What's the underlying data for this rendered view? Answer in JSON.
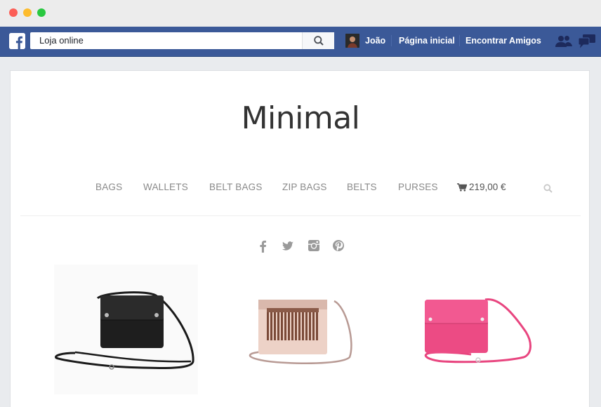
{
  "facebook": {
    "search_value": "Loja online",
    "user_name": "João",
    "home_link": "Página inicial",
    "find_friends_link": "Encontrar Amigos",
    "brand_color": "#3b5998"
  },
  "store": {
    "title": "Minimal",
    "nav": [
      "BAGS",
      "WALLETS",
      "BELT BAGS",
      "ZIP BAGS",
      "BELTS",
      "PURSES"
    ],
    "cart_total": "219,00 €",
    "social_icons": [
      "facebook-icon",
      "twitter-icon",
      "instagram-icon",
      "pinterest-icon"
    ],
    "products": [
      {
        "name": "black crossbody bag",
        "color": "#1c1c1c"
      },
      {
        "name": "beige fringe crossbody bag",
        "color": "#e8c8bc"
      },
      {
        "name": "pink crossbody bag",
        "color": "#e9447d"
      }
    ]
  }
}
